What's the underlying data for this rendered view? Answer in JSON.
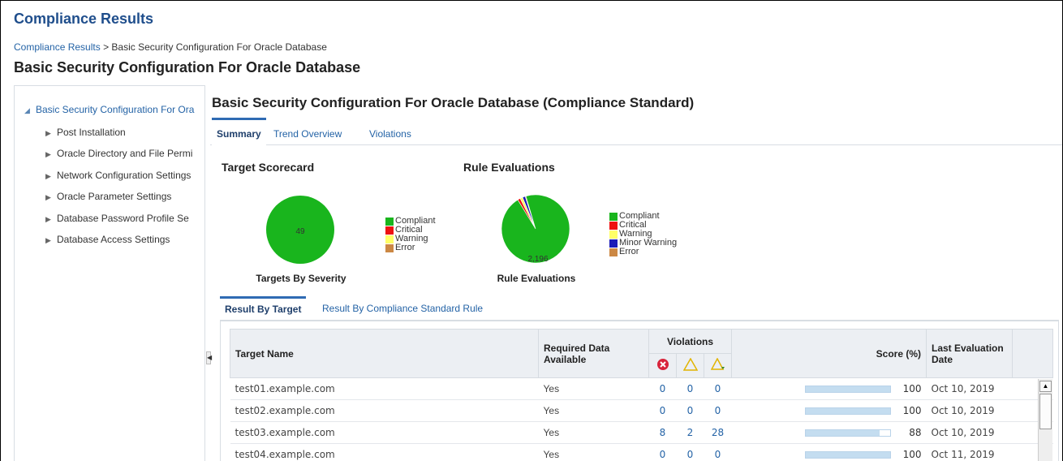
{
  "app": {
    "title": "Compliance Results"
  },
  "breadcrumb": {
    "link": "Compliance Results",
    "separator": ">",
    "current": "Basic Security Configuration For Oracle Database"
  },
  "page": {
    "title": "Basic Security Configuration For Oracle Database"
  },
  "tree": {
    "root": "Basic Security Configuration For Ora",
    "items": [
      {
        "label": "Post Installation"
      },
      {
        "label": "Oracle Directory and File Permi"
      },
      {
        "label": "Network Configuration Settings"
      },
      {
        "label": "Oracle Parameter Settings"
      },
      {
        "label": "Database Password Profile Se"
      },
      {
        "label": "Database Access Settings"
      }
    ]
  },
  "main": {
    "title": "Basic Security Configuration For Oracle Database (Compliance Standard)",
    "tabs": [
      {
        "label": "Summary",
        "active": true
      },
      {
        "label": "Trend Overview",
        "active": false
      },
      {
        "label": "Violations",
        "active": false
      }
    ]
  },
  "scorecard": {
    "heading": "Target Scorecard",
    "caption": "Targets By Severity",
    "pie_label": "49",
    "legend": [
      "Compliant",
      "Critical",
      "Warning",
      "Error"
    ]
  },
  "rules": {
    "heading": "Rule Evaluations",
    "caption": "Rule Evaluations",
    "pie_label": "2,196",
    "legend": [
      "Compliant",
      "Critical",
      "Warning",
      "Minor Warning",
      "Error"
    ]
  },
  "colors": {
    "compliant": "#19b51d",
    "critical": "#ee1111",
    "warning": "#ffff66",
    "minor_warning": "#1a1ab8",
    "error": "#cc8844",
    "link": "#2463a6"
  },
  "chart_data": [
    {
      "type": "pie",
      "title": "Targets By Severity",
      "categories": [
        "Compliant",
        "Critical",
        "Warning",
        "Error"
      ],
      "values": [
        49,
        0,
        0,
        0
      ]
    },
    {
      "type": "pie",
      "title": "Rule Evaluations",
      "categories": [
        "Compliant",
        "Critical",
        "Warning",
        "Minor Warning",
        "Error"
      ],
      "values": [
        2196,
        30,
        28,
        30,
        8
      ]
    }
  ],
  "results": {
    "subtabs": [
      {
        "label": "Result By Target",
        "active": true
      },
      {
        "label": "Result By Compliance Standard Rule",
        "active": false
      }
    ],
    "columns": {
      "target": "Target Name",
      "required": "Required Data Available",
      "violations": "Violations",
      "score": "Score (%)",
      "last_eval": "Last Evaluation Date"
    },
    "violation_icons": [
      "critical-icon",
      "warning-icon",
      "minor-warning-icon"
    ],
    "rows": [
      {
        "name": "test01.example.com",
        "required": "Yes",
        "critical": "0",
        "warning": "0",
        "minor": "0",
        "score": "100",
        "score_fraction": 1.0,
        "date": "Oct 10, 2019"
      },
      {
        "name": "test02.example.com",
        "required": "Yes",
        "critical": "0",
        "warning": "0",
        "minor": "0",
        "score": "100",
        "score_fraction": 1.0,
        "date": "Oct 10, 2019"
      },
      {
        "name": "test03.example.com",
        "required": "Yes",
        "critical": "8",
        "warning": "2",
        "minor": "28",
        "score": "88",
        "score_fraction": 0.88,
        "date": "Oct 10, 2019"
      },
      {
        "name": "test04.example.com",
        "required": "Yes",
        "critical": "0",
        "warning": "0",
        "minor": "0",
        "score": "100",
        "score_fraction": 1.0,
        "date": "Oct 11, 2019"
      }
    ]
  }
}
